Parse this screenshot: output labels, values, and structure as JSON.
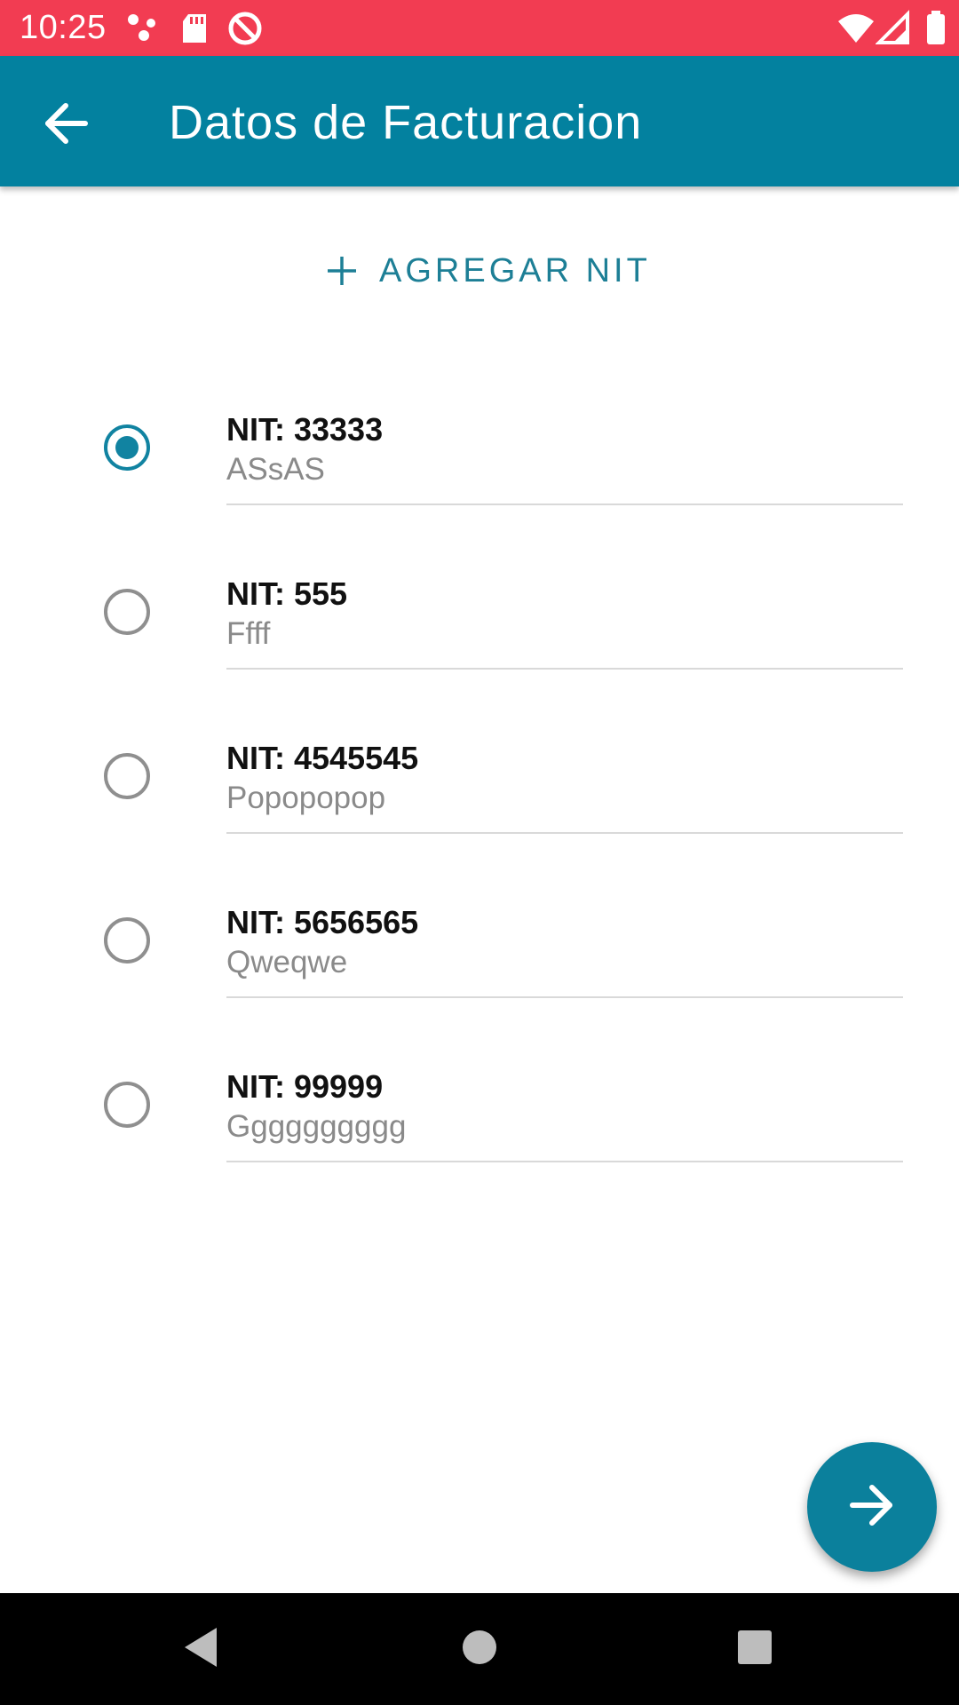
{
  "status_bar": {
    "time": "10:25",
    "left_icons": [
      "notification-dots-icon",
      "sd-card-icon",
      "data-saver-icon"
    ],
    "right_icons": [
      "wifi-icon",
      "cellular-signal-icon",
      "battery-icon"
    ],
    "background_color": "#f23c52"
  },
  "app_bar": {
    "title": "Datos de Facturacion",
    "back_icon": "arrow-left-icon",
    "background_color": "#03819f"
  },
  "add_nit": {
    "label": "AGREGAR NIT",
    "icon": "plus-icon",
    "color": "#1d7f96"
  },
  "nit_list": {
    "selected_index": 0,
    "items": [
      {
        "nit": "NIT: 33333",
        "name": "ASsAS",
        "selected": true
      },
      {
        "nit": "NIT: 555",
        "name": "Ffff",
        "selected": false
      },
      {
        "nit": "NIT: 4545545",
        "name": "Popopopop",
        "selected": false
      },
      {
        "nit": "NIT: 5656565",
        "name": "Qweqwe",
        "selected": false
      },
      {
        "nit": "NIT: 99999",
        "name": "Gggggggggg",
        "selected": false
      }
    ]
  },
  "fab": {
    "icon": "arrow-right-icon",
    "color": "#0b809c"
  },
  "nav_bar": {
    "icons": [
      "back-triangle-icon",
      "home-circle-icon",
      "recents-square-icon"
    ]
  }
}
